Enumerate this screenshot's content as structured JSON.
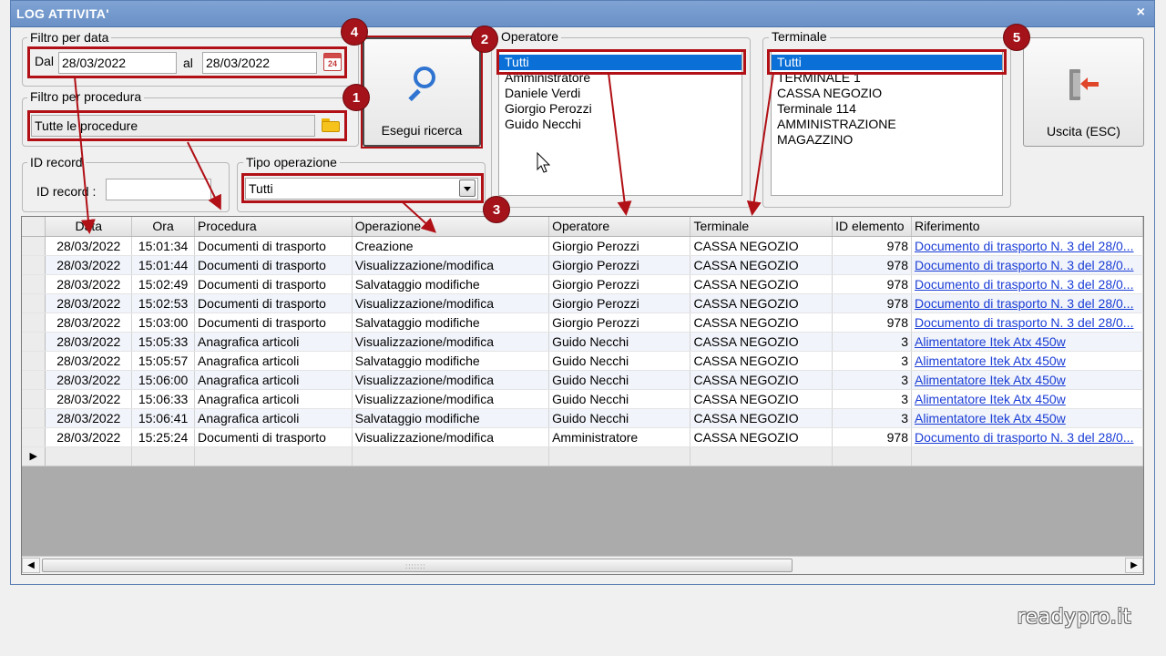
{
  "window": {
    "title": "LOG ATTIVITA'",
    "close_glyph": "×"
  },
  "filtro_data": {
    "legend": "Filtro per data",
    "dal_label": "Dal",
    "dal_value": "28/03/2022",
    "al_label": "al",
    "al_value": "28/03/2022",
    "calendar_icon_text": "24"
  },
  "filtro_procedura": {
    "legend": "Filtro per procedura",
    "value": "Tutte le procedure"
  },
  "id_record": {
    "legend": "ID record",
    "label": "ID record :",
    "value": ""
  },
  "tipo_operazione": {
    "legend": "Tipo operazione",
    "value": "Tutti"
  },
  "search_button": {
    "label": "Esegui ricerca"
  },
  "operatore": {
    "legend": "Operatore",
    "items": [
      "Tutti",
      "Amministratore",
      "Daniele Verdi",
      "Giorgio Perozzi",
      "Guido Necchi"
    ]
  },
  "terminale": {
    "legend": "Terminale",
    "items": [
      "Tutti",
      "TERMINALE 1",
      "CASSA NEGOZIO",
      "Terminale 114",
      "AMMINISTRAZIONE",
      "MAGAZZINO"
    ]
  },
  "exit_button": {
    "label": "Uscita (ESC)"
  },
  "badges": [
    "1",
    "2",
    "3",
    "4",
    "5"
  ],
  "grid": {
    "columns": [
      "Data",
      "Ora",
      "Procedura",
      "Operazione",
      "Operatore",
      "Terminale",
      "ID elemento",
      "Riferimento"
    ],
    "rows": [
      [
        "28/03/2022",
        "15:01:34",
        "Documenti di trasporto",
        "Creazione",
        "Giorgio Perozzi",
        "CASSA NEGOZIO",
        "978",
        "Documento di trasporto N. 3 del 28/0..."
      ],
      [
        "28/03/2022",
        "15:01:44",
        "Documenti di trasporto",
        "Visualizzazione/modifica",
        "Giorgio Perozzi",
        "CASSA NEGOZIO",
        "978",
        "Documento di trasporto N. 3 del 28/0..."
      ],
      [
        "28/03/2022",
        "15:02:49",
        "Documenti di trasporto",
        "Salvataggio modifiche",
        "Giorgio Perozzi",
        "CASSA NEGOZIO",
        "978",
        "Documento di trasporto N. 3 del 28/0..."
      ],
      [
        "28/03/2022",
        "15:02:53",
        "Documenti di trasporto",
        "Visualizzazione/modifica",
        "Giorgio Perozzi",
        "CASSA NEGOZIO",
        "978",
        "Documento di trasporto N. 3 del 28/0..."
      ],
      [
        "28/03/2022",
        "15:03:00",
        "Documenti di trasporto",
        "Salvataggio modifiche",
        "Giorgio Perozzi",
        "CASSA NEGOZIO",
        "978",
        "Documento di trasporto N. 3 del 28/0..."
      ],
      [
        "28/03/2022",
        "15:05:33",
        "Anagrafica articoli",
        "Visualizzazione/modifica",
        "Guido Necchi",
        "CASSA NEGOZIO",
        "3",
        "Alimentatore Itek Atx 450w"
      ],
      [
        "28/03/2022",
        "15:05:57",
        "Anagrafica articoli",
        "Salvataggio modifiche",
        "Guido Necchi",
        "CASSA NEGOZIO",
        "3",
        "Alimentatore Itek Atx 450w"
      ],
      [
        "28/03/2022",
        "15:06:00",
        "Anagrafica articoli",
        "Visualizzazione/modifica",
        "Guido Necchi",
        "CASSA NEGOZIO",
        "3",
        "Alimentatore Itek Atx 450w"
      ],
      [
        "28/03/2022",
        "15:06:33",
        "Anagrafica articoli",
        "Visualizzazione/modifica",
        "Guido Necchi",
        "CASSA NEGOZIO",
        "3",
        "Alimentatore Itek Atx 450w"
      ],
      [
        "28/03/2022",
        "15:06:41",
        "Anagrafica articoli",
        "Salvataggio modifiche",
        "Guido Necchi",
        "CASSA NEGOZIO",
        "3",
        "Alimentatore Itek Atx 450w"
      ],
      [
        "28/03/2022",
        "15:25:24",
        "Documenti di trasporto",
        "Visualizzazione/modifica",
        "Amministratore",
        "CASSA NEGOZIO",
        "978",
        "Documento di trasporto N. 3 del 28/0..."
      ]
    ],
    "new_row_marker": "▶"
  },
  "watermark": "readypro.it",
  "colors": {
    "titlebar": "#6a90c7",
    "selection": "#0a6fd6",
    "annotation_red": "#b01016",
    "link": "#1a3dd6"
  }
}
